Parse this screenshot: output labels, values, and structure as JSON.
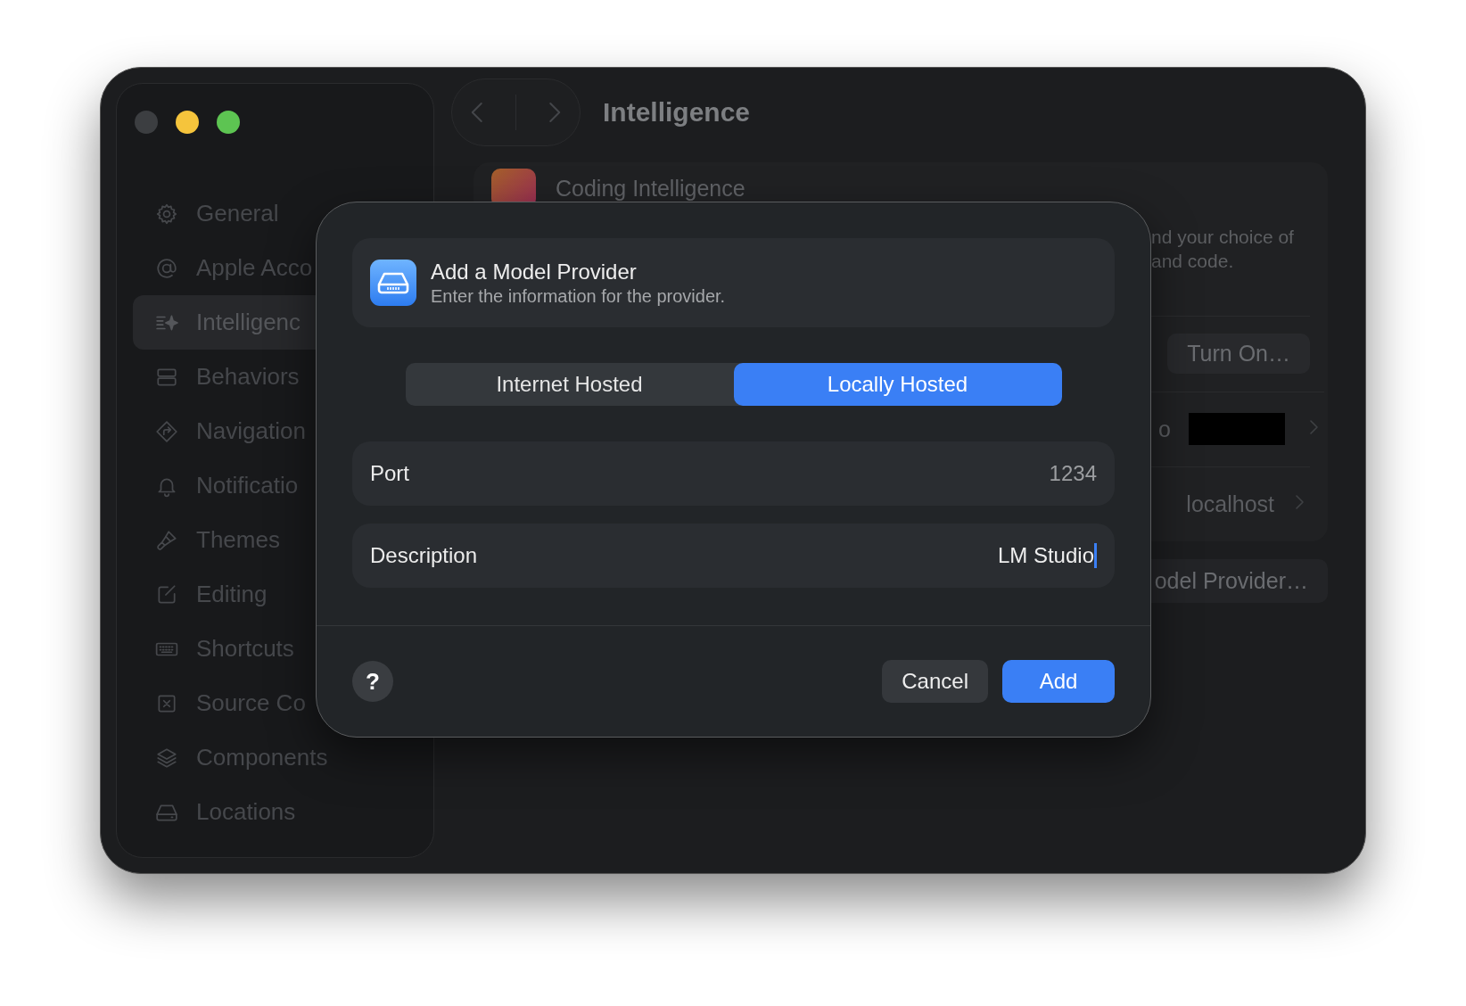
{
  "window": {
    "traffic_lights": [
      {
        "color": "#3c3e41"
      },
      {
        "color": "#f5c43c"
      },
      {
        "color": "#5dc452"
      }
    ]
  },
  "sidebar": {
    "items": [
      {
        "label": "General",
        "selected": false
      },
      {
        "label": "Apple Acco",
        "selected": false
      },
      {
        "label": "Intelligenc",
        "selected": true
      },
      {
        "label": "Behaviors",
        "selected": false
      },
      {
        "label": "Navigation",
        "selected": false
      },
      {
        "label": "Notificatio",
        "selected": false
      },
      {
        "label": "Themes",
        "selected": false
      },
      {
        "label": "Editing",
        "selected": false
      },
      {
        "label": "Shortcuts",
        "selected": false
      },
      {
        "label": "Source Co",
        "selected": false
      },
      {
        "label": "Components",
        "selected": false
      },
      {
        "label": "Locations",
        "selected": false
      }
    ]
  },
  "toolbar": {
    "title": "Intelligence"
  },
  "settings_card": {
    "title": "Coding Intelligence",
    "description": [
      "nd your choice of",
      "and code."
    ],
    "turn_on_button": "Turn On…",
    "account_row": {
      "value": "o"
    },
    "host_row": {
      "value": "localhost"
    }
  },
  "add_provider_button": "odel Provider…",
  "dialog": {
    "title": "Add a Model Provider",
    "subtitle": "Enter the information for the provider.",
    "segments": [
      {
        "label": "Internet Hosted",
        "selected": false
      },
      {
        "label": "Locally Hosted",
        "selected": true
      }
    ],
    "fields": [
      {
        "label": "Port",
        "placeholder": "1234",
        "focused": false
      },
      {
        "label": "Description",
        "value": "LM Studio",
        "focused": true
      }
    ],
    "help_button": "?",
    "buttons": [
      {
        "label": "Cancel",
        "kind": "secondary"
      },
      {
        "label": "Add",
        "kind": "primary"
      }
    ]
  }
}
